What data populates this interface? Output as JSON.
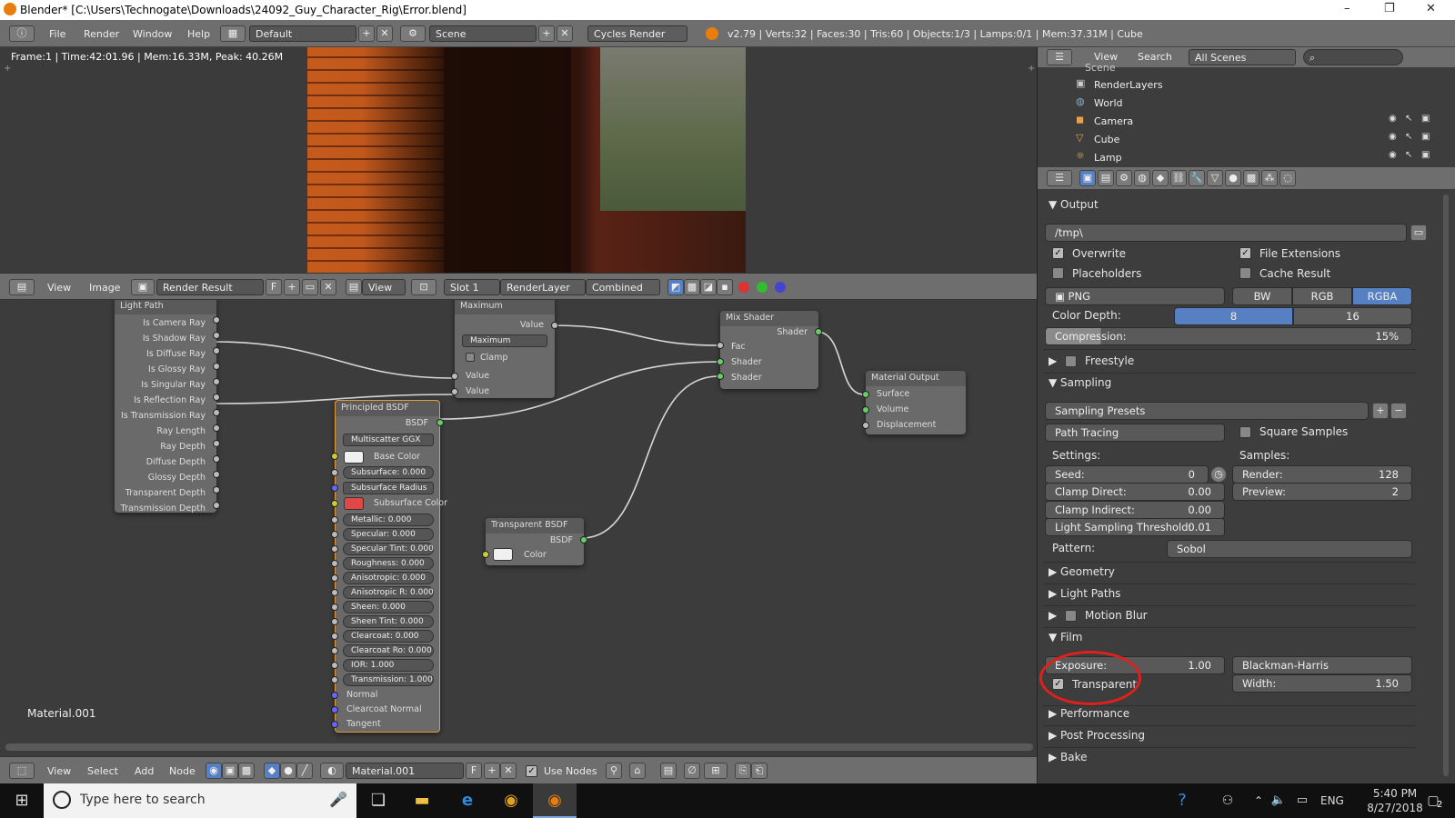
{
  "window": {
    "title": "Blender* [C:\\Users\\Technogate\\Downloads\\24092_Guy_Character_Rig\\Error.blend]",
    "minimize": "–",
    "maximize": "❐",
    "close": "✕"
  },
  "menubar": {
    "items": [
      "File",
      "Render",
      "Window",
      "Help"
    ],
    "layout": "Default",
    "scene": "Scene",
    "engine": "Cycles Render",
    "stats": "v2.79 | Verts:32 | Faces:30 | Tris:60 | Objects:1/3 | Lamps:0/1 | Mem:37.31M | Cube"
  },
  "viewport": {
    "info": "Frame:1 | Time:42:01.96 | Mem:16.33M, Peak: 40.26M"
  },
  "image_editor": {
    "view": "View",
    "image": "Image",
    "result": "Render Result",
    "f": "F",
    "view2": "View",
    "slot": "Slot 1",
    "layer": "RenderLayer",
    "pass": "Combined"
  },
  "nodes": {
    "light_path": {
      "title": "Light Path",
      "outputs": [
        "Is Camera Ray",
        "Is Shadow Ray",
        "Is Diffuse Ray",
        "Is Glossy Ray",
        "Is Singular Ray",
        "Is Reflection Ray",
        "Is Transmission Ray",
        "Ray Length",
        "Ray Depth",
        "Diffuse Depth",
        "Glossy Depth",
        "Transparent Depth",
        "Transmission Depth"
      ]
    },
    "maximum": {
      "title": "Maximum",
      "out": "Value",
      "op": "Maximum",
      "clamp": "Clamp",
      "in1": "Value",
      "in2": "Value"
    },
    "mix": {
      "title": "Mix Shader",
      "out": "Shader",
      "fac": "Fac",
      "s1": "Shader",
      "s2": "Shader"
    },
    "output": {
      "title": "Material Output",
      "surface": "Surface",
      "volume": "Volume",
      "disp": "Displacement"
    },
    "principled": {
      "title": "Principled BSDF",
      "out": "BSDF",
      "dist": "Multiscatter GGX",
      "base": "Base Color",
      "subsurface": "Subsurface:",
      "subsurface_v": "0.000",
      "ss_radius": "Subsurface Radius",
      "ss_color": "Subsurface Color",
      "fields": [
        [
          "Metallic:",
          "0.000"
        ],
        [
          "Specular:",
          "0.000"
        ],
        [
          "Specular Tint:",
          "0.000"
        ],
        [
          "Roughness:",
          "0.000"
        ],
        [
          "Anisotropic:",
          "0.000"
        ],
        [
          "Anisotropic R:",
          "0.000"
        ],
        [
          "Sheen:",
          "0.000"
        ],
        [
          "Sheen Tint:",
          "0.000"
        ],
        [
          "Clearcoat:",
          "0.000"
        ],
        [
          "Clearcoat Ro:",
          "0.000"
        ],
        [
          "IOR:",
          "1.000"
        ],
        [
          "Transmission:",
          "1.000"
        ]
      ],
      "normal": "Normal",
      "cc_normal": "Clearcoat Normal",
      "tangent": "Tangent"
    },
    "transparent": {
      "title": "Transparent BSDF",
      "out": "BSDF",
      "color": "Color"
    },
    "material_label": "Material.001"
  },
  "node_header": {
    "items": [
      "View",
      "Select",
      "Add",
      "Node"
    ],
    "material": "Material.001",
    "f": "F",
    "use_nodes": "Use Nodes"
  },
  "outliner": {
    "view": "View",
    "search": "Search",
    "filter": "All Scenes",
    "scene": "Scene",
    "items": [
      "RenderLayers",
      "World",
      "Camera",
      "Cube",
      "Lamp"
    ]
  },
  "props": {
    "output": {
      "header": "Output",
      "path": "/tmp\\",
      "overwrite": "Overwrite",
      "file_ext": "File Extensions",
      "placeholders": "Placeholders",
      "cache": "Cache Result",
      "format": "PNG",
      "bw": "BW",
      "rgb": "RGB",
      "rgba": "RGBA",
      "depth_label": "Color Depth:",
      "d8": "8",
      "d16": "16",
      "compression": "Compression:",
      "compression_v": "15%"
    },
    "freestyle": "Freestyle",
    "sampling": {
      "header": "Sampling",
      "presets": "Sampling Presets",
      "method": "Path Tracing",
      "square": "Square Samples",
      "settings": "Settings:",
      "samples": "Samples:",
      "seed": "Seed:",
      "seed_v": "0",
      "clamp_direct": "Clamp Direct:",
      "clamp_direct_v": "0.00",
      "clamp_indirect": "Clamp Indirect:",
      "clamp_indirect_v": "0.00",
      "lst": "Light Sampling Threshold:",
      "lst_v": "0.01",
      "render": "Render:",
      "render_v": "128",
      "preview": "Preview:",
      "preview_v": "2",
      "pattern": "Pattern:",
      "pattern_v": "Sobol"
    },
    "geometry": "Geometry",
    "light_paths": "Light Paths",
    "motion_blur": "Motion Blur",
    "film": {
      "header": "Film",
      "exposure": "Exposure:",
      "exposure_v": "1.00",
      "filter": "Blackman-Harris",
      "transparent": "Transparent",
      "width": "Width:",
      "width_v": "1.50"
    },
    "performance": "Performance",
    "post": "Post Processing",
    "bake": "Bake"
  },
  "taskbar": {
    "search": "Type here to search",
    "lang": "ENG",
    "time": "5:40 PM",
    "date": "8/27/2018",
    "notif": "2"
  },
  "colors": {
    "highlight_circle": "#e0201c",
    "selected": "#5680c2"
  }
}
